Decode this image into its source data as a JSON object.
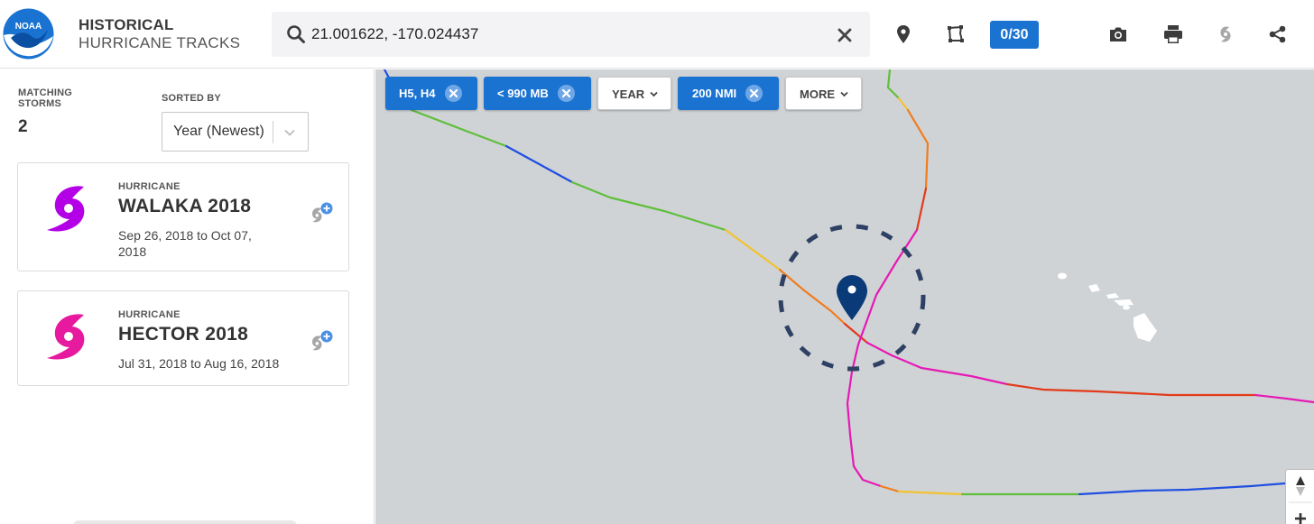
{
  "header": {
    "logo_text": "NOAA",
    "title_line1": "HISTORICAL",
    "title_line2": "HURRICANE TRACKS",
    "search": {
      "value": "21.001622, -170.024437"
    },
    "counter": "0/30",
    "icons": [
      "search-icon",
      "close-icon",
      "location-pin-icon",
      "polygon-select-icon",
      "camera-icon",
      "print-icon",
      "hurricane-icon",
      "share-icon"
    ]
  },
  "sidebar": {
    "matching_label": "MATCHING STORMS",
    "matching_count": "2",
    "sorted_label": "SORTED BY",
    "sort_value": "Year (Newest)",
    "storms": [
      {
        "category": "HURRICANE",
        "name": "WALAKA 2018",
        "dates": "Sep 26, 2018 to Oct 07, 2018",
        "color": "#b400e6"
      },
      {
        "category": "HURRICANE",
        "name": "HECTOR 2018",
        "dates": "Jul 31, 2018 to Aug 16, 2018",
        "color": "#e6199f"
      }
    ]
  },
  "map": {
    "filters": [
      {
        "label": "H5, H4",
        "active": true
      },
      {
        "label": "< 990 MB",
        "active": true
      },
      {
        "label": "YEAR",
        "active": false
      },
      {
        "label": "200 NMI",
        "active": true
      },
      {
        "label": "MORE",
        "active": false
      }
    ],
    "colors": {
      "water": "#d0d3d6",
      "land": "#ffffff",
      "marker": "#0a3a78",
      "radius": "#2e4164",
      "accent": "#1a73d1",
      "track_td": "#1f4fe0",
      "track_ts": "#5fbf3b",
      "track_h1": "#f2c230",
      "track_h2": "#f07c1e",
      "track_h3": "#e23a1a",
      "track_h4": "#e619b4"
    }
  }
}
